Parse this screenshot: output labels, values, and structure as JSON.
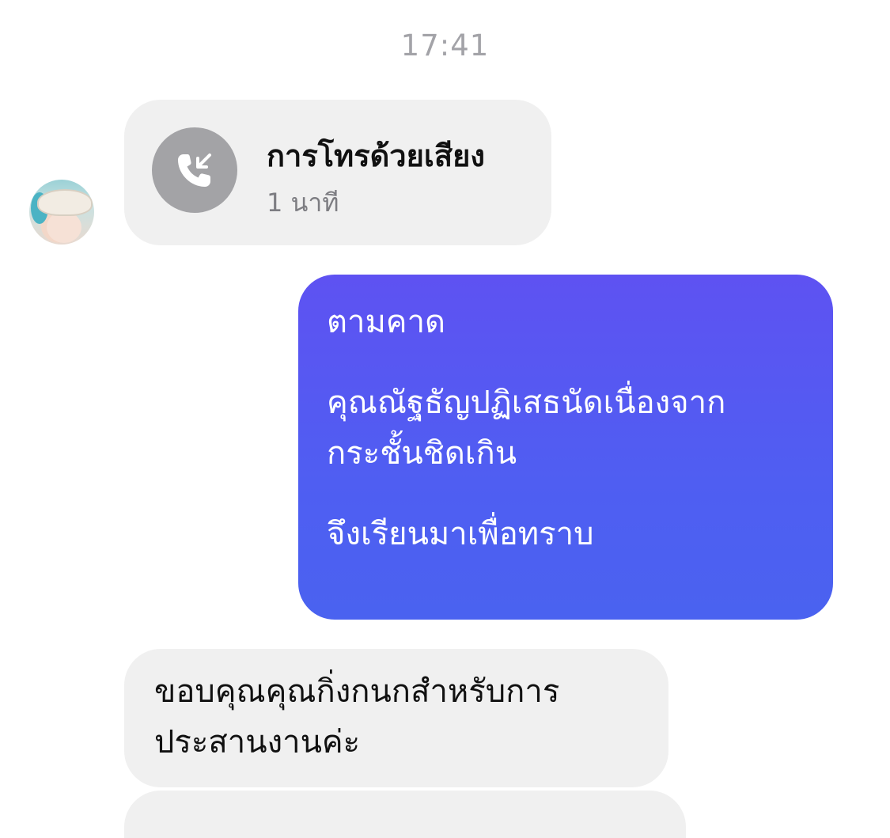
{
  "chat": {
    "timestamp": "17:41",
    "call": {
      "title": "การโทรด้วยเสียง",
      "duration": "1 นาที",
      "icon": "incoming-call-icon"
    },
    "outgoing": {
      "lines": [
        "ตามคาด",
        "คุณณัฐธัญปฏิเสธนัดเนื่องจาก",
        "กระชั้นชิดเกิน",
        "จึงเรียนมาเพื่อทราบ"
      ]
    },
    "incoming": {
      "lines": [
        "ขอบคุณคุณกิ่งกนกสำหรับการ",
        "ประสานงานค่ะ"
      ]
    }
  },
  "colors": {
    "outgoing_bubble_top": "#5e52f2",
    "outgoing_bubble_bottom": "#4a62f0",
    "incoming_bubble": "#f0f0f0",
    "call_icon_circle": "#a3a3a6",
    "timestamp_text": "#a3a3a8"
  }
}
